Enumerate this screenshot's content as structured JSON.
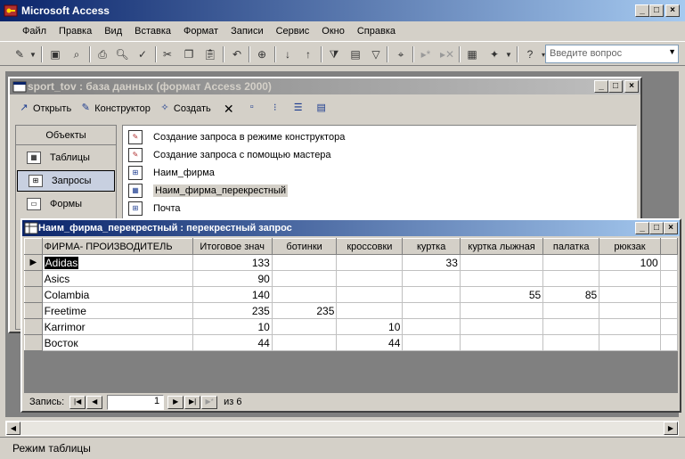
{
  "app": {
    "title": "Microsoft Access"
  },
  "menu": [
    "Файл",
    "Правка",
    "Вид",
    "Вставка",
    "Формат",
    "Записи",
    "Сервис",
    "Окно",
    "Справка"
  ],
  "help": {
    "placeholder": "Введите вопрос"
  },
  "db_window": {
    "title": "sport_tov : база данных (формат Access 2000)",
    "toolbar": {
      "open": "Открыть",
      "design": "Конструктор",
      "create": "Создать"
    },
    "objects_header": "Объекты",
    "objects": [
      "Таблицы",
      "Запросы",
      "Формы"
    ],
    "list": [
      "Создание запроса в режиме конструктора",
      "Создание запроса с помощью мастера",
      "Наим_фирма",
      "Наим_фирма_перекрестный",
      "Почта"
    ]
  },
  "query_window": {
    "title": "Наим_фирма_перекрестный : перекрестный запрос",
    "columns": [
      "ФИРМА- ПРОИЗВОДИТЕЛЬ",
      "Итоговое знач",
      "ботинки",
      "кроссовки",
      "куртка",
      "куртка лыжная",
      "палатка",
      "рюкзак"
    ],
    "rows": [
      [
        "Adidas",
        "133",
        "",
        "",
        "33",
        "",
        "",
        "100"
      ],
      [
        "Asics",
        "90",
        "",
        "",
        "",
        "",
        "",
        ""
      ],
      [
        "Colambia",
        "140",
        "",
        "",
        "",
        "55",
        "85",
        ""
      ],
      [
        "Freetime",
        "235",
        "235",
        "",
        "",
        "",
        "",
        ""
      ],
      [
        "Karrimor",
        "10",
        "",
        "10",
        "",
        "",
        "",
        ""
      ],
      [
        "Восток",
        "44",
        "",
        "44",
        "",
        "",
        "",
        ""
      ]
    ],
    "nav": {
      "label": "Запись:",
      "current": "1",
      "of": "из 6"
    }
  },
  "status": "Режим таблицы",
  "colors": {
    "title_active": "#0A246A",
    "title_inactive": "#808080",
    "face": "#D4D0C8"
  }
}
